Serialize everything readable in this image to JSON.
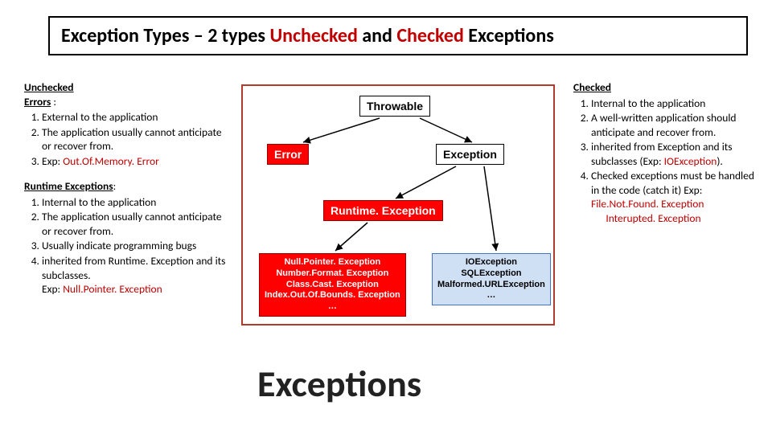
{
  "title": {
    "pre": "Exception Types – 2 types ",
    "hl1": "Unchecked",
    "mid": " and ",
    "hl2": "Checked",
    "post": " Exceptions"
  },
  "left": {
    "unchecked_head": "Unchecked",
    "errors_head": "Errors",
    "errors_colon": " :",
    "errors": {
      "i1": "External to the application",
      "i2": "The application usually cannot anticipate or recover from.",
      "i3_pre": " Exp:  ",
      "i3_ex": "Out.Of.Memory. Error"
    },
    "rt_head": "Runtime Exceptions",
    "rt_colon": ":",
    "rt": {
      "i1": "Internal to the application",
      "i2": "The application usually cannot anticipate or recover from.",
      "i3": "Usually indicate programming bugs",
      "i4_pre": "inherited from Runtime. Exception and its subclasses.",
      "i4_ex_label": "Exp: ",
      "i4_ex": "Null.Pointer. Exception"
    }
  },
  "right": {
    "checked_head": "Checked",
    "items": {
      "i1": "Internal to the application",
      "i2": "A well-written application should anticipate and recover from.",
      "i3_pre": "inherited from Exception and its subclasses (Exp: ",
      "i3_ex": "IOException",
      "i3_post": ").",
      "i4_pre": "Checked exceptions must be handled in the code (catch it) Exp: ",
      "i4_ex1": "File.Not.Found. Exception",
      "i4_ex2": "Interupted. Exception"
    }
  },
  "diagram": {
    "throwable": "Throwable",
    "error": "Error",
    "exception": "Exception",
    "runtime_exception": "Runtime. Exception",
    "left_list": {
      "l1": "Null.Pointer. Exception",
      "l2": "Number.Format. Exception",
      "l3": "Class.Cast. Exception",
      "l4": "Index.Out.Of.Bounds. Exception",
      "l5": "…"
    },
    "right_list": {
      "l1": "IOException",
      "l2": "SQLException",
      "l3": "Malformed.URLException",
      "l4": "…"
    }
  },
  "footer": "Exceptions"
}
